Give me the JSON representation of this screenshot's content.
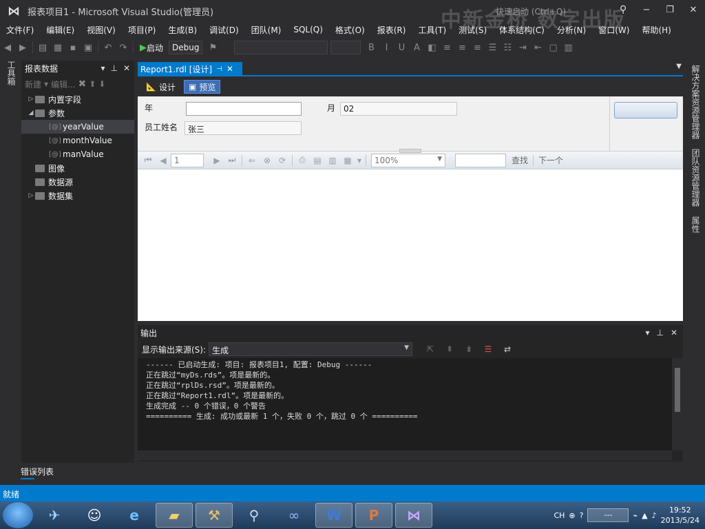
{
  "window": {
    "title": "报表项目1 - Microsoft Visual Studio(管理员)",
    "quick_launch": "快速启动 (Ctrl+Q)",
    "watermark": "中新金桥 数字出版"
  },
  "menu": [
    "文件(F)",
    "编辑(E)",
    "视图(V)",
    "项目(P)",
    "生成(B)",
    "调试(D)",
    "团队(M)",
    "SQL(Q)",
    "格式(O)",
    "报表(R)",
    "工具(T)",
    "测试(S)",
    "体系结构(C)",
    "分析(N)",
    "窗口(W)",
    "帮助(H)"
  ],
  "toolbar": {
    "start_label": "启动",
    "config": "Debug"
  },
  "left_tab": "工具箱",
  "report_data": {
    "title": "报表数据",
    "new_label": "新建",
    "edit_label": "编辑...",
    "tree": [
      {
        "label": "内置字段",
        "level": 0,
        "expander": "▷"
      },
      {
        "label": "参数",
        "level": 0,
        "expander": "◢"
      },
      {
        "label": "yearValue",
        "level": 1,
        "selected": true
      },
      {
        "label": "monthValue",
        "level": 1
      },
      {
        "label": "manValue",
        "level": 1
      },
      {
        "label": "图像",
        "level": 0,
        "expander": ""
      },
      {
        "label": "数据源",
        "level": 0,
        "expander": ""
      },
      {
        "label": "数据集",
        "level": 0,
        "expander": "▷"
      }
    ]
  },
  "doc_tab": {
    "label": "Report1.rdl [设计]"
  },
  "modes": {
    "design": "设计",
    "preview": "预览"
  },
  "params": {
    "year_label": "年",
    "year_value": "",
    "month_label": "月",
    "month_value": "02",
    "name_label": "员工姓名",
    "name_value": "张三"
  },
  "report_toolbar": {
    "page": "1",
    "zoom": "100%",
    "find_label": "查找",
    "next_label": "下一个"
  },
  "output": {
    "title": "输出",
    "source_label": "显示输出来源(S):",
    "source_value": "生成",
    "lines": [
      "------ 已启动生成: 项目: 报表项目1, 配置: Debug ------",
      "正在跳过“myDs.rds”。项是最新的。",
      "正在跳过“rplDs.rsd”。项是最新的。",
      "正在跳过“Report1.rdl”。项是最新的。",
      "生成完成 -- 0 个错误，0 个警告",
      "========== 生成: 成功或最新 1 个，失败 0 个，跳过 0 个 =========="
    ]
  },
  "right_tabs": [
    "解决方案资源管理器",
    "团队资源管理器",
    "属性"
  ],
  "error_list": "错误列表",
  "status": "就绪",
  "taskbar": {
    "lang": "CH",
    "time": "19:52",
    "date": "2013/5/24",
    "tray_box": "---"
  }
}
